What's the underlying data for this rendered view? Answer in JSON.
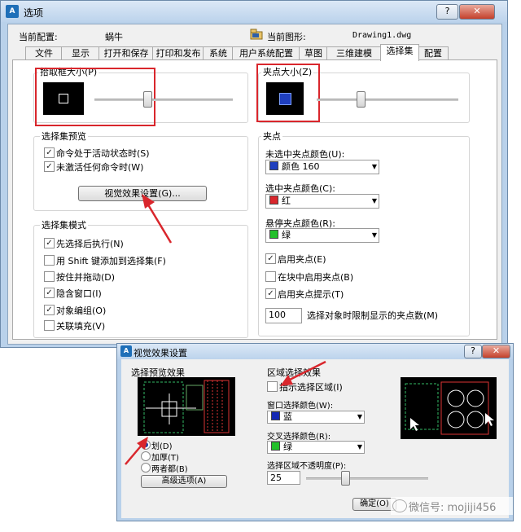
{
  "main": {
    "title": "选项",
    "help_button": "?",
    "close_button": "✕",
    "current_profile_label": "当前配置:",
    "current_profile_value": "蜗牛",
    "current_drawing_label": "当前图形:",
    "current_drawing_value": "Drawing1.dwg",
    "tabs": [
      "文件",
      "显示",
      "打开和保存",
      "打印和发布",
      "系统",
      "用户系统配置",
      "草图",
      "三维建模",
      "选择集",
      "配置"
    ],
    "pickbox": {
      "title": "拾取框大小(P)"
    },
    "grip_size": {
      "title": "夹点大小(Z)"
    },
    "preview": {
      "title": "选择集预览",
      "items": [
        "命令处于活动状态时(S)",
        "未激活任何命令时(W)"
      ],
      "visual_button": "视觉效果设置(G)..."
    },
    "modes": {
      "title": "选择集模式",
      "items": [
        "先选择后执行(N)",
        "用 Shift 键添加到选择集(F)",
        "按住并拖动(D)",
        "隐含窗口(I)",
        "对象编组(O)",
        "关联填充(V)"
      ]
    },
    "grips": {
      "title": "夹点",
      "unselected_label": "未选中夹点颜色(U):",
      "unselected_value": "颜色 160",
      "selected_label": "选中夹点颜色(C):",
      "selected_value": "红",
      "hover_label": "悬停夹点颜色(R):",
      "hover_value": "绿",
      "enable_grips": "启用夹点(E)",
      "enable_in_blocks": "在块中启用夹点(B)",
      "enable_tips": "启用夹点提示(T)",
      "limit_value": "100",
      "limit_label": "选择对象时限制显示的夹点数(M)"
    }
  },
  "dialog": {
    "title": "视觉效果设置",
    "help_button": "?",
    "close_button": "✕",
    "preview_effect": {
      "title": "选择预览效果",
      "radios": [
        "划(D)",
        "加厚(T)",
        "两者都(B)"
      ],
      "advanced_button": "高级选项(A)"
    },
    "area_effect": {
      "title": "区域选择效果",
      "indicate_area": "指示选择区域(I)",
      "window_color_label": "窗口选择颜色(W):",
      "window_color_value": "蓝",
      "cross_color_label": "交叉选择颜色(R):",
      "cross_color_value": "绿",
      "opacity_label": "选择区域不透明度(P):",
      "opacity_value": "25"
    },
    "ok_button": "确定(O)"
  },
  "watermark": "微信号: mojiji456",
  "colors": {
    "color160": "#1f3fbf",
    "red": "#d9262c",
    "green": "#22c02a",
    "blue": "#1428b4",
    "annotation_red": "#d9262c"
  },
  "values": {
    "pickbox_slider": 0.38,
    "grip_slider": 0.31,
    "opacity_slider": 0.32,
    "opacity_percent": 25
  }
}
